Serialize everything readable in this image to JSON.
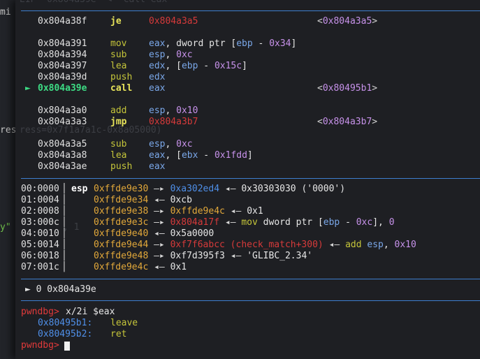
{
  "background": {
    "left_fragments": [
      "mi",
      "res",
      "y\""
    ],
    "terminal_ghost": {
      "top_partial": "EIP  0x804a39e  ◂— call eax",
      "mid_partial": "ress=0x7f1a7a1c-0x8a05000)",
      "lower_partial": ", 1"
    }
  },
  "disasm": [
    {
      "addr": "0x804a38f",
      "mnem": "je",
      "op_parts": [
        [
          "red",
          "0x804a3a5"
        ]
      ],
      "target": "<0x804a3a5>",
      "jump": true
    },
    {
      "gap": true
    },
    {
      "addr": "0x804a391",
      "mnem": "mov",
      "op_parts": [
        [
          "reg",
          "eax"
        ],
        [
          "white",
          ", dword ptr ["
        ],
        [
          "reg",
          "ebp"
        ],
        [
          "white",
          " - "
        ],
        [
          "num",
          "0x34"
        ],
        [
          "white",
          "]"
        ]
      ]
    },
    {
      "addr": "0x804a394",
      "mnem": "sub",
      "op_parts": [
        [
          "reg",
          "esp"
        ],
        [
          "white",
          ", "
        ],
        [
          "num",
          "0xc"
        ]
      ]
    },
    {
      "addr": "0x804a397",
      "mnem": "lea",
      "op_parts": [
        [
          "reg",
          "edx"
        ],
        [
          "white",
          ", ["
        ],
        [
          "reg",
          "ebp"
        ],
        [
          "white",
          " - "
        ],
        [
          "num",
          "0x15c"
        ],
        [
          "white",
          "]"
        ]
      ]
    },
    {
      "addr": "0x804a39d",
      "mnem": "push",
      "op_parts": [
        [
          "reg",
          "edx"
        ]
      ]
    },
    {
      "addr": "0x804a39e",
      "mnem": "call",
      "op_parts": [
        [
          "reg",
          "eax"
        ]
      ],
      "target": "<0x80495b1>",
      "current": true
    },
    {
      "gap": true
    },
    {
      "addr": "0x804a3a0",
      "mnem": "add",
      "op_parts": [
        [
          "reg",
          "esp"
        ],
        [
          "white",
          ", "
        ],
        [
          "num",
          "0x10"
        ]
      ]
    },
    {
      "addr": "0x804a3a3",
      "mnem": "jmp",
      "op_parts": [
        [
          "red",
          "0x804a3b7"
        ]
      ],
      "target": "<0x804a3b7>",
      "jump": true
    },
    {
      "gap": true
    },
    {
      "addr": "0x804a3a5",
      "mnem": "sub",
      "op_parts": [
        [
          "reg",
          "esp"
        ],
        [
          "white",
          ", "
        ],
        [
          "num",
          "0xc"
        ]
      ]
    },
    {
      "addr": "0x804a3a8",
      "mnem": "lea",
      "op_parts": [
        [
          "reg",
          "eax"
        ],
        [
          "white",
          ", ["
        ],
        [
          "reg",
          "ebx"
        ],
        [
          "white",
          " - "
        ],
        [
          "num",
          "0x1fdd"
        ],
        [
          "white",
          "]"
        ]
      ]
    },
    {
      "addr": "0x804a3ae",
      "mnem": "push",
      "op_parts": [
        [
          "reg",
          "eax"
        ]
      ]
    }
  ],
  "current_marker": "►",
  "stack": [
    {
      "idx": "00:0000",
      "reg": "esp",
      "parts": [
        [
          "yel",
          "0xffde9e30"
        ],
        [
          "arr",
          " —▸ "
        ],
        [
          "blue",
          "0xa302ed4"
        ],
        [
          "arr",
          " ◂— "
        ],
        [
          "white",
          "0x30303030 ('0000')"
        ]
      ]
    },
    {
      "idx": "01:0004",
      "reg": "",
      "parts": [
        [
          "yel",
          "0xffde9e34"
        ],
        [
          "arr",
          " ◂— "
        ],
        [
          "white",
          "0xcb"
        ]
      ]
    },
    {
      "idx": "02:0008",
      "reg": "",
      "parts": [
        [
          "yel",
          "0xffde9e38"
        ],
        [
          "arr",
          " —▸ "
        ],
        [
          "yel",
          "0xffde9e4c"
        ],
        [
          "arr",
          " ◂— "
        ],
        [
          "white",
          "0x1"
        ]
      ]
    },
    {
      "idx": "03:000c",
      "reg": "",
      "parts": [
        [
          "yel",
          "0xffde9e3c"
        ],
        [
          "arr",
          " —▸ "
        ],
        [
          "red",
          "0x804a17f"
        ],
        [
          "arr",
          " ◂— "
        ],
        [
          "grn",
          "mov"
        ],
        [
          "white",
          " "
        ],
        [
          "white",
          "dword ptr ["
        ],
        [
          "reg",
          "ebp"
        ],
        [
          "white",
          " - "
        ],
        [
          "num",
          "0xc"
        ],
        [
          "white",
          "], "
        ],
        [
          "num",
          "0"
        ]
      ]
    },
    {
      "idx": "04:0010",
      "reg": "",
      "parts": [
        [
          "yel",
          "0xffde9e40"
        ],
        [
          "arr",
          " ◂— "
        ],
        [
          "white",
          "0x5a0000"
        ]
      ]
    },
    {
      "idx": "05:0014",
      "reg": "",
      "parts": [
        [
          "yel",
          "0xffde9e44"
        ],
        [
          "arr",
          " —▸ "
        ],
        [
          "red",
          "0xf7f6abcc (check_match+300)"
        ],
        [
          "arr",
          " ◂— "
        ],
        [
          "grn",
          "add"
        ],
        [
          "white",
          " "
        ],
        [
          "reg",
          "esp"
        ],
        [
          "white",
          ", "
        ],
        [
          "num",
          "0x10"
        ]
      ]
    },
    {
      "idx": "06:0018",
      "reg": "",
      "parts": [
        [
          "yel",
          "0xffde9e48"
        ],
        [
          "arr",
          " —▸ "
        ],
        [
          "white",
          "0xf7d395f3"
        ],
        [
          "arr",
          " ◂— "
        ],
        [
          "white",
          "'GLIBC_2.34'"
        ]
      ]
    },
    {
      "idx": "07:001c",
      "reg": "",
      "parts": [
        [
          "yel",
          "0xffde9e4c"
        ],
        [
          "arr",
          " ◂— "
        ],
        [
          "white",
          "0x1"
        ]
      ]
    }
  ],
  "backtrace": "► 0 0x804a39e",
  "prompt": "pwndbg>",
  "command": "x/2i $eax",
  "x_output": [
    {
      "addr": "0x80495b1:",
      "mnem": "leave"
    },
    {
      "addr": "0x80495b2:",
      "mnem": "ret"
    }
  ],
  "colors": {
    "separator": "#3e7fcf",
    "prompt": "#e23a3a",
    "current": "#3ddc84"
  }
}
